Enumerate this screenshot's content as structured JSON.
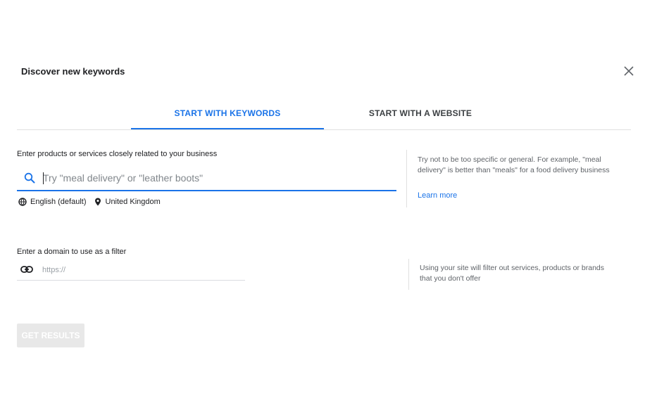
{
  "dialog": {
    "title": "Discover new keywords",
    "close_icon": "close-icon"
  },
  "tabs": [
    {
      "label": "START WITH KEYWORDS",
      "active": true
    },
    {
      "label": "START WITH A WEBSITE",
      "active": false
    }
  ],
  "keywords": {
    "label": "Enter products or services closely related to your business",
    "placeholder": "Try \"meal delivery\" or \"leather boots\"",
    "value": "",
    "language": "English (default)",
    "location": "United Kingdom",
    "help_text": "Try not to be too specific or general. For example, \"meal delivery\" is better than \"meals\" for a food delivery business",
    "learn_more": "Learn more"
  },
  "domain": {
    "label": "Enter a domain to use as a filter",
    "placeholder": "https://",
    "value": "",
    "help_text": "Using your site will filter out services, products or brands that you don't offer"
  },
  "actions": {
    "get_results": "GET RESULTS",
    "enabled": false
  },
  "colors": {
    "accent": "#1a73e8",
    "text": "#202124",
    "secondary_text": "#5f6368",
    "divider": "#e0e0e0",
    "disabled_button": "#e8e8e8"
  }
}
